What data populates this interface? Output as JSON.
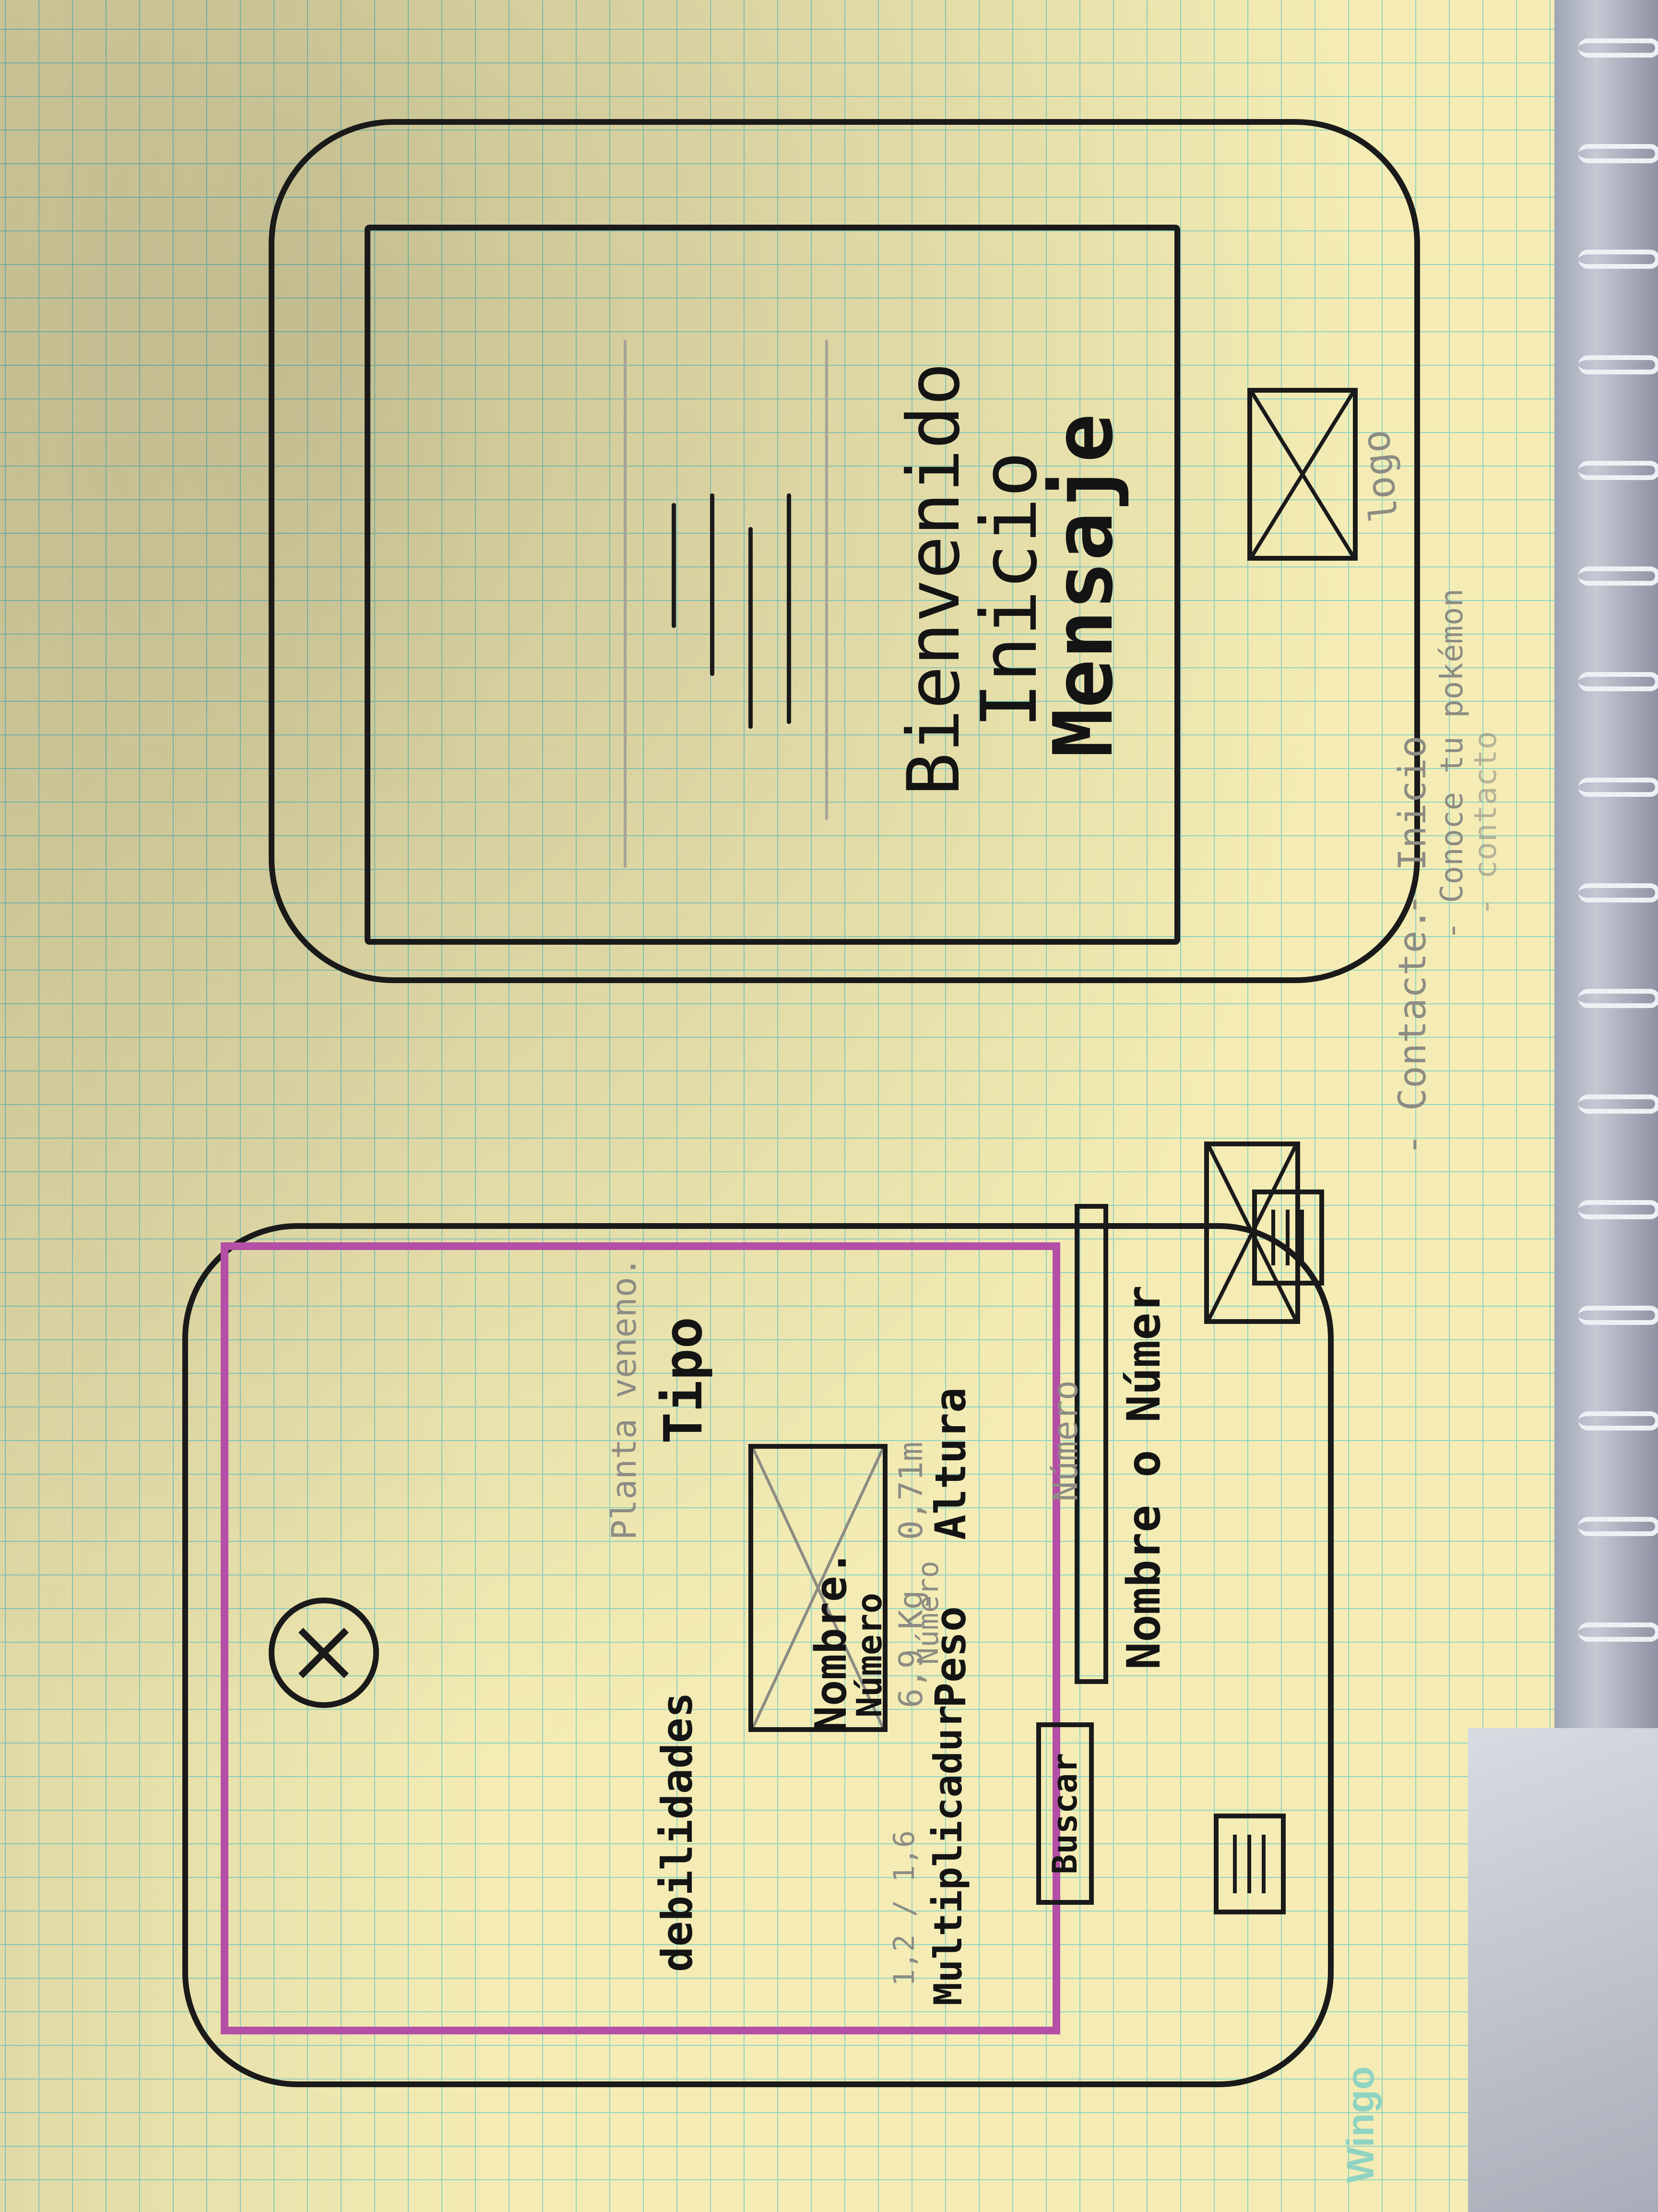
{
  "screen_home": {
    "message_lines": [
      "Mensaje",
      "Inicio",
      "Bienvenido"
    ],
    "logo_icon": "image-placeholder-x",
    "menu_icon": "hamburger-menu"
  },
  "annotations": {
    "logo": "logo",
    "menu_items": [
      "- Inicio",
      "- Conoce tu pokémon",
      "- contacto",
      "- Contacte."
    ]
  },
  "screen_search": {
    "logo_icon": "image-placeholder-x",
    "menu_icon": "hamburger-menu",
    "search_placeholder": "Nombre o Númer",
    "search_value": "Número",
    "search_button": "Buscar",
    "result_image_caption_number": "Número",
    "result_image_caption_name": "Nombre.",
    "image_top_label": "Número",
    "stats": [
      {
        "label": "Altura",
        "value": "0,71m"
      },
      {
        "label": "Peso",
        "value": "6,9 Kg"
      },
      {
        "label": "Multiplicadur",
        "value": "1,2 / 1,6"
      }
    ],
    "type_label": "Tipo",
    "type_value": "Planta veneno.",
    "weakness_label": "debilidades",
    "close_icon": "close-x-circle",
    "highlight_color": "#b34fa6"
  },
  "paper": {
    "brand": "Wingo",
    "grid_color": "#8fd3c2",
    "paper_color": "#f4ecb4",
    "ink_color": "#1a1a1a"
  }
}
